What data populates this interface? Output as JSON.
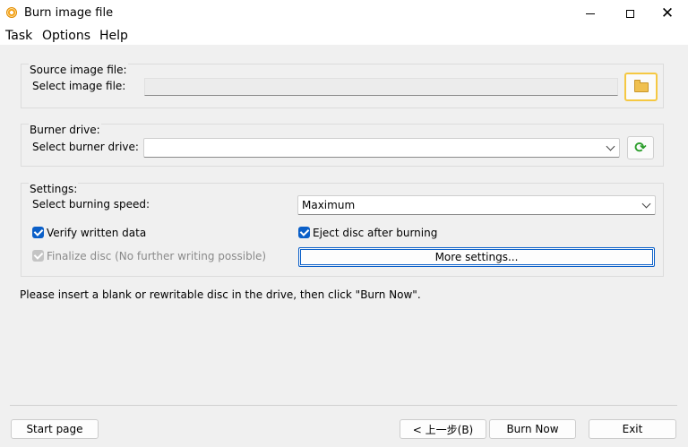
{
  "window": {
    "title": "Burn image file"
  },
  "menu": {
    "items": [
      "Task",
      "Options",
      "Help"
    ]
  },
  "source": {
    "group_title": "Source image file:",
    "select_label": "Select image file:",
    "value": ""
  },
  "burner": {
    "group_title": "Burner drive:",
    "select_label": "Select burner drive:",
    "value": ""
  },
  "settings": {
    "group_title": "Settings:",
    "speed_label": "Select burning speed:",
    "speed_value": "Maximum",
    "verify_label": "Verify written data",
    "verify_checked": true,
    "eject_label": "Eject disc after burning",
    "eject_checked": true,
    "finalize_label": "Finalize disc (No further writing possible)",
    "finalize_checked": true,
    "finalize_disabled": true,
    "more_settings_label": "More settings..."
  },
  "status": {
    "message": "Please insert a blank or rewritable disc in the drive, then click \"Burn Now\"."
  },
  "footer": {
    "start_page_label": "Start page",
    "back_label": "< 上一步(B)",
    "burn_now_label": "Burn Now",
    "exit_label": "Exit"
  },
  "icons": {
    "app": "disc-burn-icon",
    "browse": "folder-icon",
    "refresh": "refresh-icon"
  },
  "colors": {
    "accent": "#0a5fc8",
    "highlight": "#f5c842",
    "refresh": "#2a9d2a"
  }
}
